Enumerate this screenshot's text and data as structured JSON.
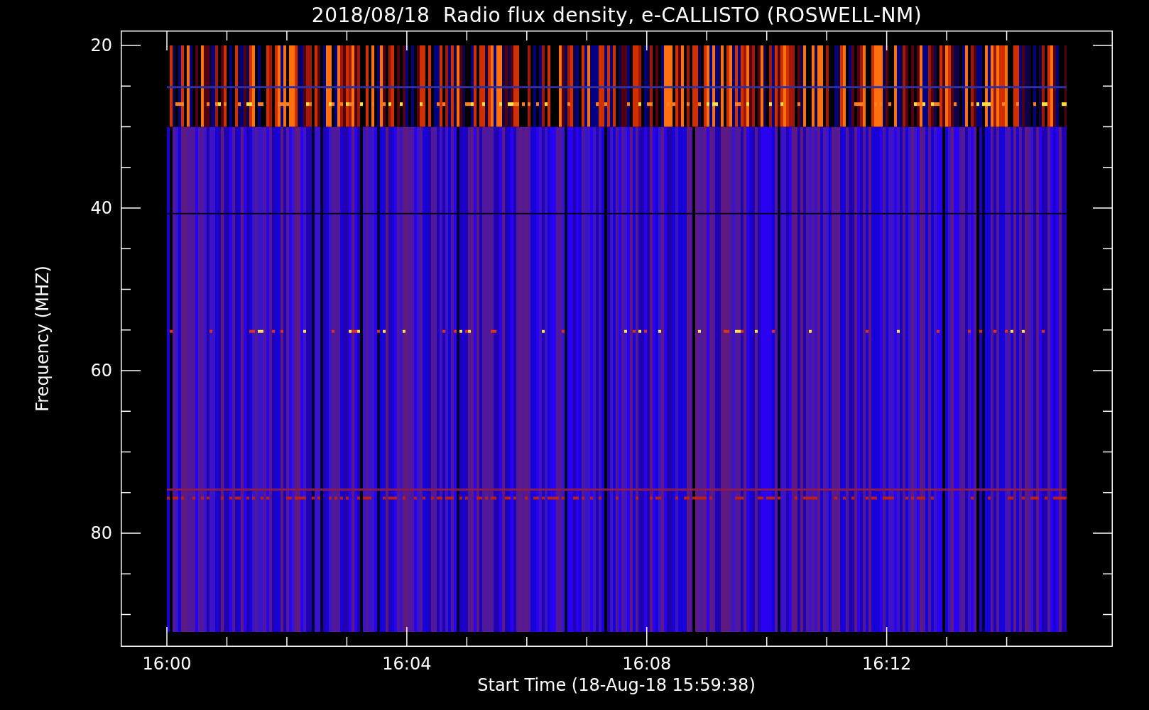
{
  "title": "2018/08/18  Radio flux density, e-CALLISTO (ROSWELL-NM)",
  "y_axis": {
    "label": "Frequency (MHZ)",
    "ticks": [
      "20",
      "40",
      "60",
      "80"
    ]
  },
  "x_axis": {
    "label": "Start Time (18-Aug-18 15:59:38)",
    "ticks": [
      "16:00",
      "16:04",
      "16:08",
      "16:12"
    ]
  }
}
